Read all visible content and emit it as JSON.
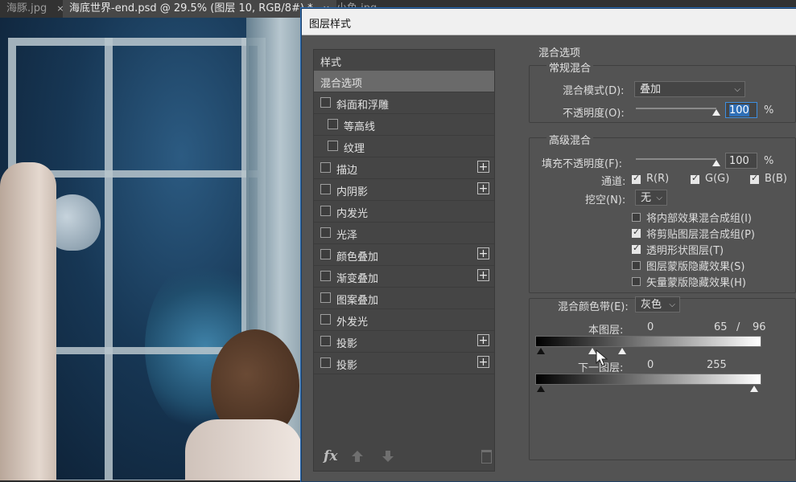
{
  "tabs": [
    {
      "label": "海豚.jpg",
      "close": "×"
    },
    {
      "label": "海底世界-end.psd @ 29.5% (图层 10, RGB/8#) *",
      "close": "×"
    },
    {
      "label": "小鱼.jpg",
      "close": ""
    }
  ],
  "dialog": {
    "title": "图层样式",
    "styles_header": "样式",
    "items": [
      {
        "label": "混合选项",
        "checkbox": false,
        "plus": false,
        "selected": true
      },
      {
        "label": "斜面和浮雕",
        "checkbox": true,
        "plus": false
      },
      {
        "label": "等高线",
        "checkbox": true,
        "plus": false,
        "indent": true
      },
      {
        "label": "纹理",
        "checkbox": true,
        "plus": false,
        "indent": true
      },
      {
        "label": "描边",
        "checkbox": true,
        "plus": true
      },
      {
        "label": "内阴影",
        "checkbox": true,
        "plus": true
      },
      {
        "label": "内发光",
        "checkbox": true,
        "plus": false
      },
      {
        "label": "光泽",
        "checkbox": true,
        "plus": false
      },
      {
        "label": "颜色叠加",
        "checkbox": true,
        "plus": true
      },
      {
        "label": "渐变叠加",
        "checkbox": true,
        "plus": true
      },
      {
        "label": "图案叠加",
        "checkbox": true,
        "plus": false
      },
      {
        "label": "外发光",
        "checkbox": true,
        "plus": false
      },
      {
        "label": "投影",
        "checkbox": true,
        "plus": true
      },
      {
        "label": "投影",
        "checkbox": true,
        "plus": true
      }
    ],
    "plus_glyph": "+",
    "fx_label": "fx",
    "blend": {
      "section_title": "混合选项",
      "general_title": "常规混合",
      "mode_label": "混合模式(D):",
      "mode_value": "叠加",
      "opacity_label": "不透明度(O):",
      "opacity_value": "100",
      "opacity_unit": "%",
      "opacity_level": 1.0,
      "advanced_title": "高级混合",
      "fill_label": "填充不透明度(F):",
      "fill_value": "100",
      "fill_unit": "%",
      "fill_level": 1.0,
      "channels_label": "通道:",
      "channels": [
        {
          "label": "R(R)",
          "checked": true
        },
        {
          "label": "G(G)",
          "checked": true
        },
        {
          "label": "B(B)",
          "checked": true
        }
      ],
      "knockout_label": "挖空(N):",
      "knockout_value": "无",
      "options": [
        {
          "label": "将内部效果混合成组(I)",
          "checked": false
        },
        {
          "label": "将剪贴图层混合成组(P)",
          "checked": true
        },
        {
          "label": "透明形状图层(T)",
          "checked": true
        },
        {
          "label": "图层蒙版隐藏效果(S)",
          "checked": false
        },
        {
          "label": "矢量蒙版隐藏效果(H)",
          "checked": false
        }
      ],
      "blend_if_label": "混合颜色带(E):",
      "blend_if_value": "灰色",
      "this_layer_label": "本图层:",
      "this_layer_low": "0",
      "this_layer_high_a": "65",
      "this_layer_sep": "/",
      "this_layer_high_b": "96",
      "under_layer_label": "下一图层:",
      "under_layer_low": "0",
      "under_layer_high": "255"
    }
  }
}
